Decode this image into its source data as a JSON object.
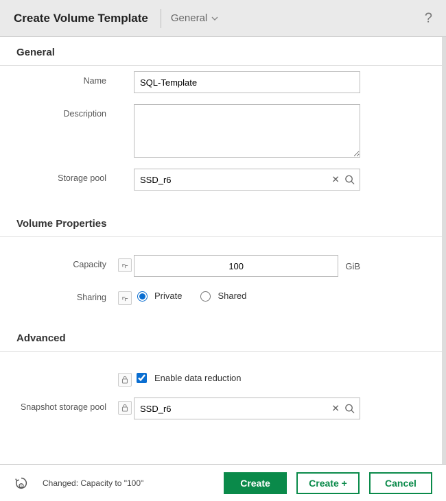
{
  "header": {
    "title": "Create Volume Template",
    "section_dropdown": "General",
    "help_tooltip": "?"
  },
  "sections": {
    "general": {
      "title": "General",
      "fields": {
        "name": {
          "label": "Name",
          "value": "SQL-Template"
        },
        "description": {
          "label": "Description",
          "value": ""
        },
        "storage_pool": {
          "label": "Storage pool",
          "value": "SSD_r6"
        }
      }
    },
    "volume_properties": {
      "title": "Volume Properties",
      "fields": {
        "capacity": {
          "label": "Capacity",
          "value": "100",
          "unit": "GiB"
        },
        "sharing": {
          "label": "Sharing",
          "options": {
            "private": "Private",
            "shared": "Shared"
          },
          "selected": "private"
        }
      }
    },
    "advanced": {
      "title": "Advanced",
      "fields": {
        "data_reduction": {
          "label": "Enable data reduction",
          "checked": true
        },
        "snapshot_pool": {
          "label": "Snapshot storage pool",
          "value": "SSD_r6"
        }
      }
    }
  },
  "footer": {
    "changed_text": "Changed: Capacity to \"100\"",
    "buttons": {
      "create": "Create",
      "create_plus": "Create +",
      "cancel": "Cancel"
    }
  }
}
